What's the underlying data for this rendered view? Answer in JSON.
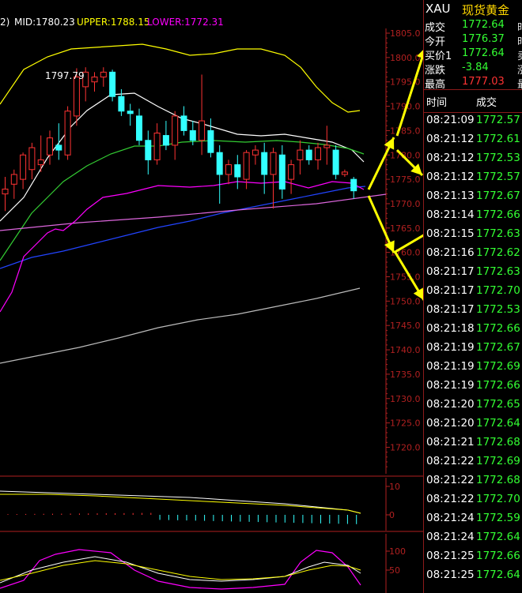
{
  "indicator": {
    "prefix": "2)",
    "mid": "MID:1780.23",
    "upper": "UPPER:1788.15",
    "lower": "LOWER:1772.31",
    "colors": {
      "mid": "#ffffff",
      "upper": "#ffff00",
      "lower": "#ff00ff"
    }
  },
  "chart_data": {
    "type": "candlestick",
    "y_axis_ticks": [
      "1805.0",
      "1800.0",
      "1795.0",
      "1790.0",
      "1785.0",
      "1780.0",
      "1775.0",
      "1770.0",
      "1765.0",
      "1760.0",
      "1755.0",
      "1750.0",
      "1745.0",
      "1740.0",
      "1735.0",
      "1730.0",
      "1725.0",
      "1720.0"
    ],
    "ylim": [
      1720,
      1805
    ],
    "annotation": "1797.79",
    "candles": [
      {
        "o": 1772.0,
        "h": 1775.5,
        "l": 1768.5,
        "c": 1773.0
      },
      {
        "o": 1774.0,
        "h": 1777.0,
        "l": 1771.0,
        "c": 1776.0
      },
      {
        "o": 1775.0,
        "h": 1780.5,
        "l": 1773.0,
        "c": 1780.0
      },
      {
        "o": 1777.0,
        "h": 1782.5,
        "l": 1775.0,
        "c": 1781.5
      },
      {
        "o": 1778.0,
        "h": 1784.0,
        "l": 1776.5,
        "c": 1779.0
      },
      {
        "o": 1780.0,
        "h": 1785.0,
        "l": 1778.0,
        "c": 1783.5
      },
      {
        "o": 1782.0,
        "h": 1786.5,
        "l": 1779.0,
        "c": 1781.0
      },
      {
        "o": 1780.0,
        "h": 1790.0,
        "l": 1779.0,
        "c": 1789.0
      },
      {
        "o": 1788.0,
        "h": 1797.8,
        "l": 1786.0,
        "c": 1796.0
      },
      {
        "o": 1794.0,
        "h": 1798.0,
        "l": 1791.0,
        "c": 1797.0
      },
      {
        "o": 1795.0,
        "h": 1797.0,
        "l": 1793.0,
        "c": 1796.0
      },
      {
        "o": 1796.0,
        "h": 1798.0,
        "l": 1794.0,
        "c": 1797.0
      },
      {
        "o": 1797.0,
        "h": 1797.5,
        "l": 1791.0,
        "c": 1792.0
      },
      {
        "o": 1792.0,
        "h": 1793.5,
        "l": 1788.0,
        "c": 1789.0
      },
      {
        "o": 1789.0,
        "h": 1790.5,
        "l": 1786.0,
        "c": 1788.5
      },
      {
        "o": 1788.0,
        "h": 1789.5,
        "l": 1782.0,
        "c": 1783.0
      },
      {
        "o": 1783.0,
        "h": 1785.0,
        "l": 1776.0,
        "c": 1779.0
      },
      {
        "o": 1779.0,
        "h": 1786.5,
        "l": 1778.0,
        "c": 1784.5
      },
      {
        "o": 1784.0,
        "h": 1787.0,
        "l": 1781.0,
        "c": 1782.0
      },
      {
        "o": 1782.0,
        "h": 1789.0,
        "l": 1779.0,
        "c": 1788.0
      },
      {
        "o": 1788.0,
        "h": 1790.0,
        "l": 1784.0,
        "c": 1785.0
      },
      {
        "o": 1785.0,
        "h": 1787.0,
        "l": 1782.0,
        "c": 1783.0
      },
      {
        "o": 1783.0,
        "h": 1796.5,
        "l": 1780.0,
        "c": 1787.0
      },
      {
        "o": 1785.0,
        "h": 1787.5,
        "l": 1779.5,
        "c": 1780.5
      },
      {
        "o": 1780.5,
        "h": 1782.0,
        "l": 1770.0,
        "c": 1776.0
      },
      {
        "o": 1776.0,
        "h": 1779.0,
        "l": 1774.0,
        "c": 1778.0
      },
      {
        "o": 1778.0,
        "h": 1780.0,
        "l": 1773.0,
        "c": 1775.5
      },
      {
        "o": 1775.0,
        "h": 1781.0,
        "l": 1773.0,
        "c": 1780.5
      },
      {
        "o": 1780.0,
        "h": 1782.0,
        "l": 1778.0,
        "c": 1781.0
      },
      {
        "o": 1780.5,
        "h": 1782.5,
        "l": 1772.0,
        "c": 1776.0
      },
      {
        "o": 1776.0,
        "h": 1781.5,
        "l": 1769.0,
        "c": 1780.5
      },
      {
        "o": 1780.0,
        "h": 1782.0,
        "l": 1771.0,
        "c": 1773.0
      },
      {
        "o": 1775.0,
        "h": 1779.0,
        "l": 1772.0,
        "c": 1778.0
      },
      {
        "o": 1779.0,
        "h": 1783.0,
        "l": 1776.0,
        "c": 1781.0
      },
      {
        "o": 1781.0,
        "h": 1782.0,
        "l": 1778.0,
        "c": 1779.0
      },
      {
        "o": 1779.0,
        "h": 1782.5,
        "l": 1777.0,
        "c": 1781.5
      },
      {
        "o": 1781.5,
        "h": 1786.0,
        "l": 1778.0,
        "c": 1782.0
      },
      {
        "o": 1781.0,
        "h": 1782.0,
        "l": 1775.0,
        "c": 1776.0
      },
      {
        "o": 1776.0,
        "h": 1777.0,
        "l": 1775.5,
        "c": 1776.5
      },
      {
        "o": 1775.0,
        "h": 1775.5,
        "l": 1771.0,
        "c": 1772.64
      }
    ],
    "up_color": "#ff3333",
    "down_color": "#33ffff",
    "macd_ticks": [
      "10",
      "0"
    ],
    "kdj_ticks": [
      "100",
      "50"
    ]
  },
  "quote": {
    "symbol": "XAU",
    "name": "现货黄金",
    "rows": [
      {
        "label": "成交",
        "value": "1772.64",
        "color": "#33ff33",
        "extra": "时"
      },
      {
        "label": "今开",
        "value": "1776.37",
        "color": "#33ff33",
        "extra": "时"
      },
      {
        "label": "买价1",
        "value": "1772.64",
        "color": "#33ff33",
        "extra": "卖"
      },
      {
        "label": "涨跌",
        "value": "-3.84",
        "color": "#33ff33",
        "extra": "涨"
      },
      {
        "label": "最高",
        "value": "1777.03",
        "color": "#ff3333",
        "extra": "最"
      }
    ]
  },
  "ticks": {
    "time_header": "时间",
    "price_header": "成交",
    "rows": [
      {
        "time": "08:21:09",
        "price": "1772.57"
      },
      {
        "time": "08:21:12",
        "price": "1772.61"
      },
      {
        "time": "08:21:12",
        "price": "1772.53"
      },
      {
        "time": "08:21:12",
        "price": "1772.57"
      },
      {
        "time": "08:21:13",
        "price": "1772.67"
      },
      {
        "time": "08:21:14",
        "price": "1772.66"
      },
      {
        "time": "08:21:15",
        "price": "1772.63"
      },
      {
        "time": "08:21:16",
        "price": "1772.62"
      },
      {
        "time": "08:21:17",
        "price": "1772.63"
      },
      {
        "time": "08:21:17",
        "price": "1772.70"
      },
      {
        "time": "08:21:17",
        "price": "1772.53"
      },
      {
        "time": "08:21:18",
        "price": "1772.66"
      },
      {
        "time": "08:21:19",
        "price": "1772.67"
      },
      {
        "time": "08:21:19",
        "price": "1772.69"
      },
      {
        "time": "08:21:19",
        "price": "1772.66"
      },
      {
        "time": "08:21:20",
        "price": "1772.65"
      },
      {
        "time": "08:21:20",
        "price": "1772.64"
      },
      {
        "time": "08:21:21",
        "price": "1772.68"
      },
      {
        "time": "08:21:22",
        "price": "1772.69"
      },
      {
        "time": "08:21:22",
        "price": "1772.68"
      },
      {
        "time": "08:21:22",
        "price": "1772.70"
      },
      {
        "time": "08:21:24",
        "price": "1772.59"
      },
      {
        "time": "08:21:24",
        "price": "1772.64"
      },
      {
        "time": "08:21:25",
        "price": "1772.66"
      },
      {
        "time": "08:21:25",
        "price": "1772.64"
      }
    ]
  }
}
